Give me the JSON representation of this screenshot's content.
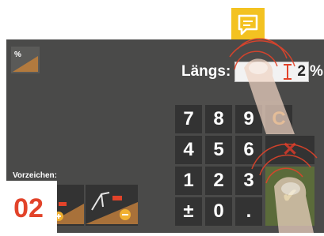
{
  "page_number": "02",
  "field": {
    "label": "Längs:",
    "value": "2",
    "unit": "%"
  },
  "keypad": {
    "keys": [
      "7",
      "8",
      "9",
      "C",
      "4",
      "5",
      "6",
      "✕",
      "1",
      "2",
      "3",
      "✔",
      "±",
      "0",
      "."
    ]
  },
  "sign": {
    "label": "Vorzeichen:"
  },
  "slope_icon_text": "%",
  "colors": {
    "screen": "#4a4a49",
    "key": "#333333",
    "accent": "#e2432a",
    "touch_rings": "#e2432a",
    "chat_icon": "#f3c221"
  },
  "icons": [
    "slope-percent-icon",
    "chat-bubble-icon",
    "text-cursor-icon",
    "slope-plus-icon",
    "slope-minus-icon",
    "finger-tap-icon"
  ]
}
